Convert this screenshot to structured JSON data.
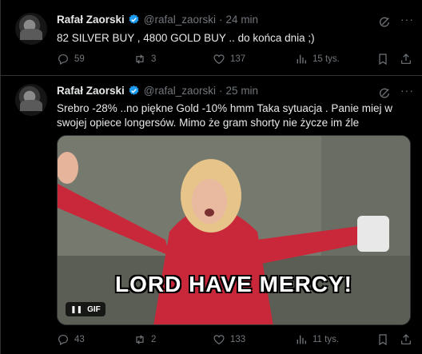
{
  "colors": {
    "background": "#000000",
    "text": "#e7e9ea",
    "muted": "#71767b",
    "verified": "#1d9bf0",
    "divider": "#2f3336"
  },
  "tweets": [
    {
      "author": "Rafał Zaorski",
      "handle": "@rafal_zaorski",
      "separator": "·",
      "time": "24 min",
      "text": "82 SILVER BUY ,  4800 GOLD BUY .. do końca dnia ;)",
      "replies": "59",
      "reposts": "3",
      "likes": "137",
      "views": "15 tys.",
      "icons": [
        "verified-icon",
        "grok-icon",
        "more-icon",
        "reply-icon",
        "repost-icon",
        "like-icon",
        "views-icon",
        "bookmark-icon",
        "share-icon"
      ]
    },
    {
      "author": "Rafał Zaorski",
      "handle": "@rafal_zaorski",
      "separator": "·",
      "time": "25 min",
      "text": "Srebro -28% ..no piękne  Gold -10% hmm Taka sytuacja . Panie miej w swojej opiece longersów. Mimo że gram shorty nie życze im źle",
      "media": {
        "caption": "LORD HAVE MERCY!",
        "badge": "GIF",
        "type": "gif"
      },
      "replies": "43",
      "reposts": "2",
      "likes": "133",
      "views": "11 tys.",
      "icons": [
        "verified-icon",
        "grok-icon",
        "more-icon",
        "pause-icon",
        "reply-icon",
        "repost-icon",
        "like-icon",
        "views-icon",
        "bookmark-icon",
        "share-icon"
      ]
    }
  ]
}
